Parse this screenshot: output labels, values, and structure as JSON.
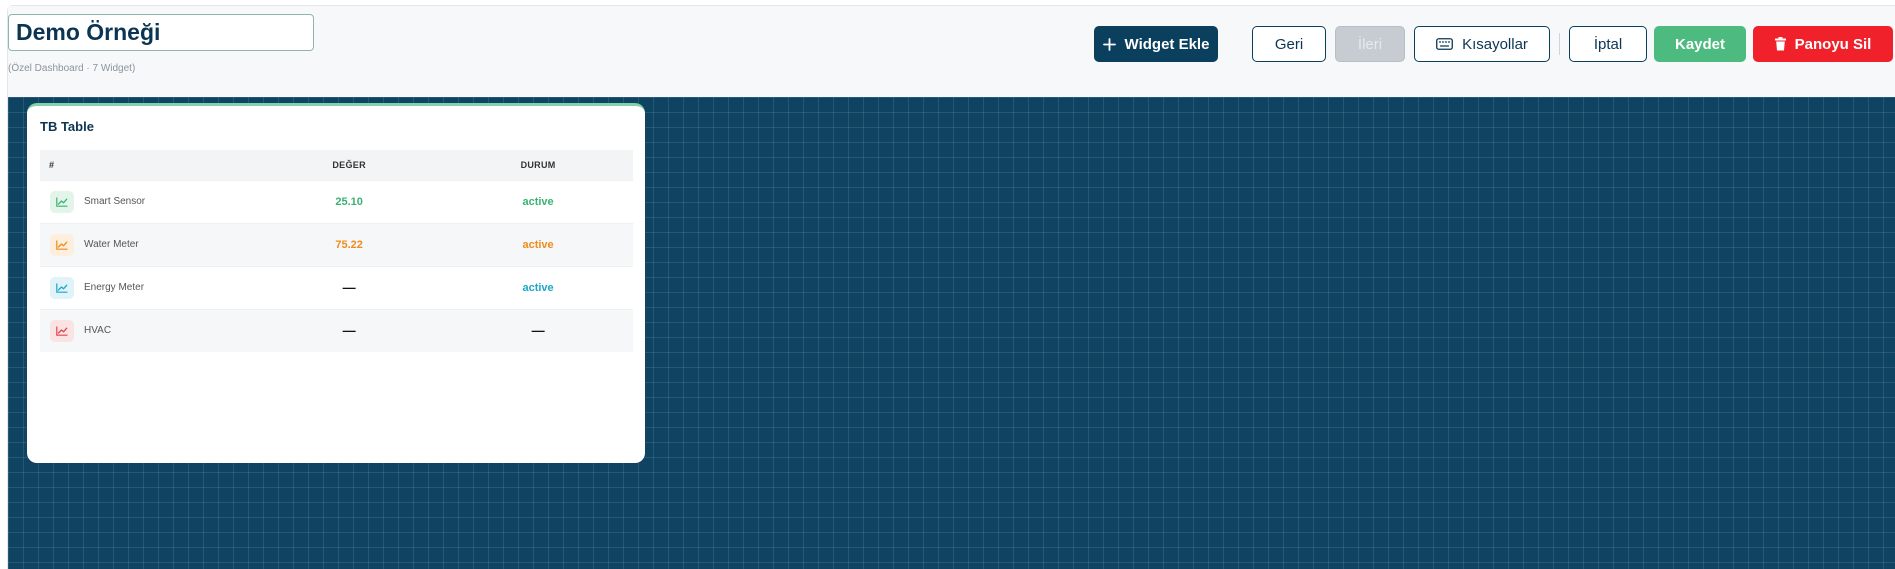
{
  "header": {
    "title": "Demo Örneği",
    "subtitle": "(Özel Dashboard · 7 Widget)"
  },
  "toolbar": {
    "add_widget": "Widget Ekle",
    "back": "Geri",
    "forward": "İleri",
    "shortcuts": "Kısayollar",
    "cancel": "İptal",
    "save": "Kaydet",
    "delete_board": "Panoyu Sil"
  },
  "widget": {
    "title": "TB Table",
    "columns": [
      "#",
      "DEĞER",
      "DURUM"
    ],
    "rows": [
      {
        "name": "Smart Sensor",
        "value": "25.10",
        "status": "active",
        "color": "#3bb273",
        "icon_bg": "#e3f5eb",
        "icon": "chart-line-icon"
      },
      {
        "name": "Water Meter",
        "value": "75.22",
        "status": "active",
        "color": "#f08c1a",
        "icon_bg": "#fdeedd",
        "icon": "chart-line-icon"
      },
      {
        "name": "Energy Meter",
        "value": "—",
        "status": "active",
        "color": "#1ba7c9",
        "icon_bg": "#dff3f9",
        "icon": "chart-line-icon"
      },
      {
        "name": "HVAC",
        "value": "—",
        "status": "—",
        "color": "#e0444c",
        "icon_bg": "#fbe3e4",
        "icon": "chart-line-icon"
      }
    ]
  },
  "colors": {
    "primary": "#0b3f5e",
    "success": "#4dbb7f",
    "danger": "#f1212b",
    "canvas": "#0e4462"
  }
}
